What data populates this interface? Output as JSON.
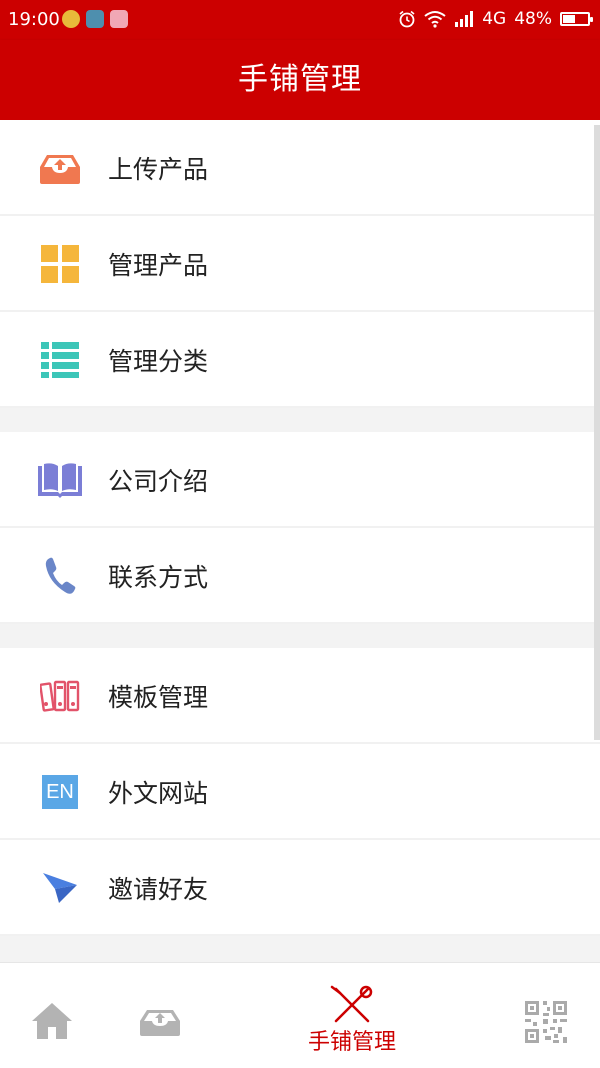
{
  "status_bar": {
    "time": "19:00",
    "network": "4G",
    "battery": "48%",
    "battery_level": 0.48
  },
  "header": {
    "title": "手铺管理"
  },
  "menu": {
    "groups": [
      {
        "items": [
          {
            "label": "上传产品",
            "icon": "upload-tray-icon"
          },
          {
            "label": "管理产品",
            "icon": "grid-icon"
          },
          {
            "label": "管理分类",
            "icon": "list-icon"
          }
        ]
      },
      {
        "items": [
          {
            "label": "公司介绍",
            "icon": "book-icon"
          },
          {
            "label": "联系方式",
            "icon": "phone-icon"
          }
        ]
      },
      {
        "items": [
          {
            "label": "模板管理",
            "icon": "binders-icon"
          },
          {
            "label": "外文网站",
            "icon": "en-icon",
            "icon_text": "EN"
          },
          {
            "label": "邀请好友",
            "icon": "paper-plane-icon"
          }
        ]
      }
    ]
  },
  "tab_bar": {
    "tabs": [
      {
        "icon": "home-icon"
      },
      {
        "icon": "upload-tray-icon"
      },
      {
        "icon": "tools-icon",
        "label": "手铺管理",
        "active": true
      },
      {
        "icon": "qr-code-icon"
      }
    ]
  },
  "colors": {
    "brand": "#cc0000",
    "upload": "#f07850",
    "grid": "#f5b63b",
    "list": "#3cc6b8",
    "book": "#7b7ed6",
    "phone": "#6a86c8",
    "binders": "#e2536a",
    "en": "#5aa7e6",
    "plane": "#4a7fe0"
  }
}
